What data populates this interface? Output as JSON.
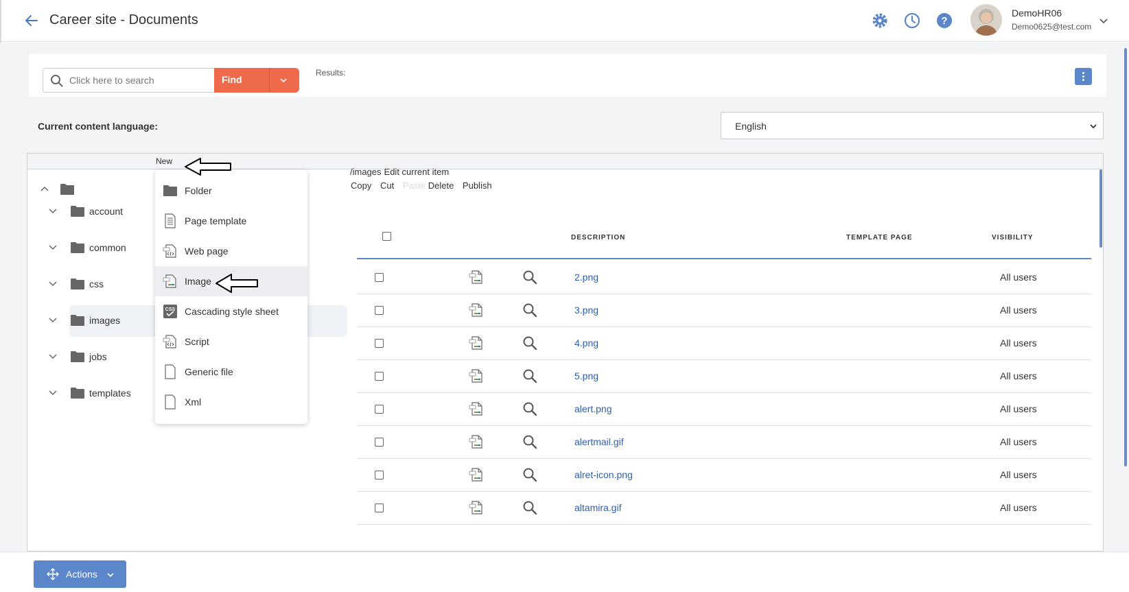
{
  "header": {
    "title": "Career site - Documents",
    "user_name": "DemoHR06",
    "user_email": "Demo0625@test.com"
  },
  "search": {
    "placeholder": "Click here to search",
    "find_label": "Find",
    "results_label": "Results:"
  },
  "language": {
    "label": "Current content language:",
    "selected": "English"
  },
  "toolbar": {
    "new_label": "New"
  },
  "tree": {
    "items": [
      {
        "label": "account"
      },
      {
        "label": "common"
      },
      {
        "label": "css"
      },
      {
        "label": "images"
      },
      {
        "label": "jobs"
      },
      {
        "label": "templates"
      }
    ]
  },
  "path": {
    "current": "/images",
    "edit_label": "Edit current item",
    "actions": [
      "Copy",
      "Cut",
      "Paste",
      "Delete",
      "Publish"
    ]
  },
  "table": {
    "columns": [
      "DESCRIPTION",
      "TEMPLATE PAGE",
      "VISIBILITY"
    ],
    "rows": [
      {
        "name": "2.png",
        "visibility": "All users"
      },
      {
        "name": "3.png",
        "visibility": "All users"
      },
      {
        "name": "4.png",
        "visibility": "All users"
      },
      {
        "name": "5.png",
        "visibility": "All users"
      },
      {
        "name": "alert.png",
        "visibility": "All users"
      },
      {
        "name": "alertmail.gif",
        "visibility": "All users"
      },
      {
        "name": "alret-icon.png",
        "visibility": "All users"
      },
      {
        "name": "altamira.gif",
        "visibility": "All users"
      }
    ]
  },
  "new_menu": {
    "items": [
      {
        "label": "Folder",
        "icon": "folder-icon"
      },
      {
        "label": "Page template",
        "icon": "page-template-icon"
      },
      {
        "label": "Web page",
        "icon": "web-page-icon"
      },
      {
        "label": "Image",
        "icon": "image-file-icon"
      },
      {
        "label": "Cascading style sheet",
        "icon": "css-icon"
      },
      {
        "label": "Script",
        "icon": "script-icon"
      },
      {
        "label": "Generic file",
        "icon": "generic-file-icon"
      },
      {
        "label": "Xml",
        "icon": "xml-file-icon"
      }
    ],
    "active_index": 3
  },
  "footer": {
    "actions_label": "Actions"
  },
  "colors": {
    "accent": "#5b86c9",
    "find": "#ee6a4a",
    "link": "#2f5fa8"
  }
}
